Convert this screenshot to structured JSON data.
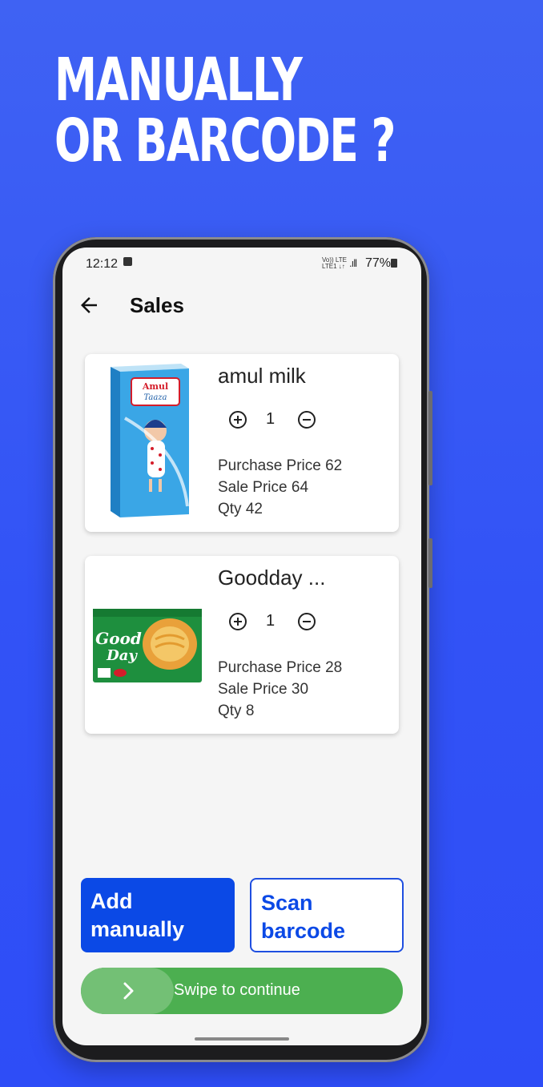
{
  "headline": {
    "line1": "MANUALLY",
    "line2": "OR BARCODE ?"
  },
  "status_bar": {
    "time": "12:12",
    "network_top": "Vo)) LTE",
    "network_bottom": "LTE1 ↓↑",
    "battery": "77%"
  },
  "app_bar": {
    "title": "Sales",
    "back_icon": "arrow-back-icon"
  },
  "products": [
    {
      "name": "amul milk",
      "quantity": "1",
      "purchase_price_label": "Purchase Price 62",
      "sale_price_label": "Sale Price 64",
      "qty_label": "Qty 42",
      "image_text_1": "Amul",
      "image_text_2": "Taaza"
    },
    {
      "name": "Goodday ...",
      "quantity": "1",
      "purchase_price_label": "Purchase Price 28",
      "sale_price_label": "Sale Price 30",
      "qty_label": "Qty 8",
      "image_text_1": "Good",
      "image_text_2": "Day"
    }
  ],
  "actions": {
    "add_manually": "Add manually",
    "scan_barcode": "Scan barcode"
  },
  "swipe": {
    "label": "Swipe to continue"
  },
  "colors": {
    "background": "#3253f6",
    "primary": "#0b49e6",
    "success": "#4caf50"
  }
}
